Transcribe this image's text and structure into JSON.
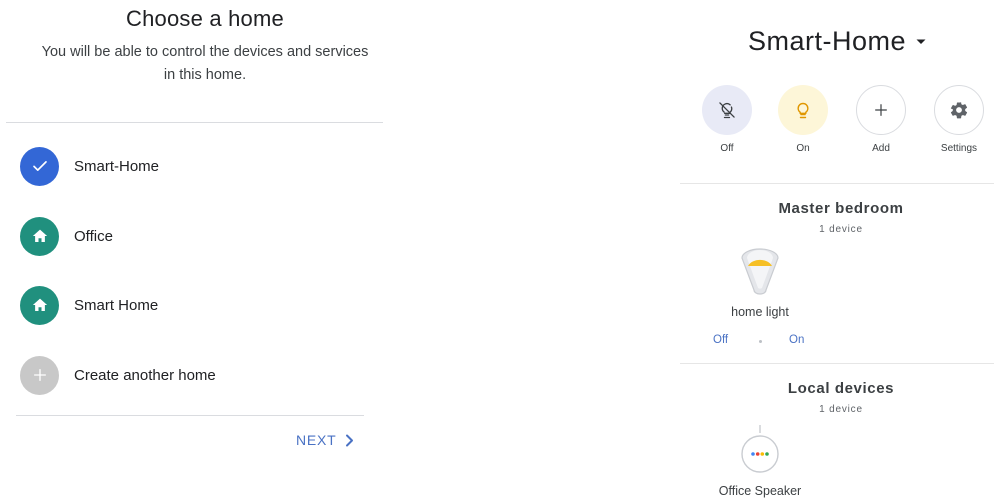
{
  "choose_home": {
    "title": "Choose a home",
    "subtitle": "You will be able to control the devices and services in this home.",
    "homes": [
      {
        "label": "Smart-Home",
        "icon": "check-icon",
        "color": "#3367d6",
        "selected": true
      },
      {
        "label": "Office",
        "icon": "home-icon",
        "color": "#20907e",
        "selected": false
      },
      {
        "label": "Smart Home",
        "icon": "home-icon",
        "color": "#20907e",
        "selected": false
      },
      {
        "label": "Create another home",
        "icon": "plus-icon",
        "color": "#c8c8c8",
        "selected": false
      }
    ],
    "next_label": "NEXT"
  },
  "home_screen": {
    "home_name": "Smart-Home",
    "quick_actions": [
      {
        "label": "Off",
        "icon": "light-off-icon"
      },
      {
        "label": "On",
        "icon": "lightbulb-icon"
      },
      {
        "label": "Add",
        "icon": "plus-icon"
      },
      {
        "label": "Settings",
        "icon": "gear-icon"
      }
    ],
    "rooms": [
      {
        "name": "Master bedroom",
        "count": "1 device",
        "device": {
          "name": "home light",
          "icon": "light-bulb-icon",
          "off_label": "Off",
          "on_label": "On"
        }
      },
      {
        "name": "Local devices",
        "count": "1 device",
        "device": {
          "name": "Office Speaker",
          "icon": "smart-speaker-icon"
        }
      }
    ]
  },
  "colors": {
    "accent_blue": "#3367d6",
    "teal": "#20907e",
    "link_blue": "#4a72c4",
    "bulb_yellow": "#f6c026"
  }
}
